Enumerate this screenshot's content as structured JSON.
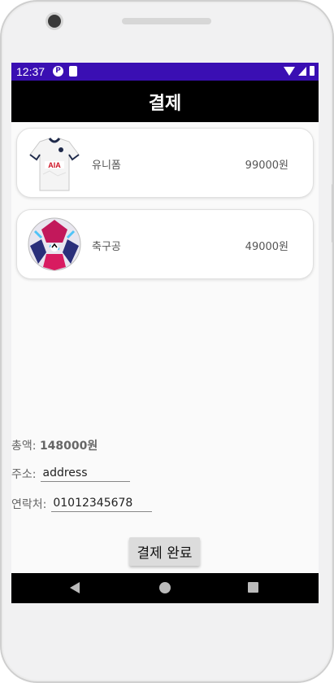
{
  "status_bar": {
    "time": "12:37"
  },
  "app_bar": {
    "title": "결제"
  },
  "cart": {
    "items": [
      {
        "name": "유니폼",
        "price": "99000원"
      },
      {
        "name": "축구공",
        "price": "49000원"
      }
    ]
  },
  "summary": {
    "total_label": "총액: ",
    "total_value": "148000원",
    "address_label": "주소:",
    "address_value": "address",
    "phone_label": "연락처:",
    "phone_value": "01012345678"
  },
  "actions": {
    "pay_label": "결제 완료"
  },
  "colors": {
    "status_bar": "#3a0fb3",
    "app_bar": "#000000",
    "nav_bar": "#000000"
  }
}
